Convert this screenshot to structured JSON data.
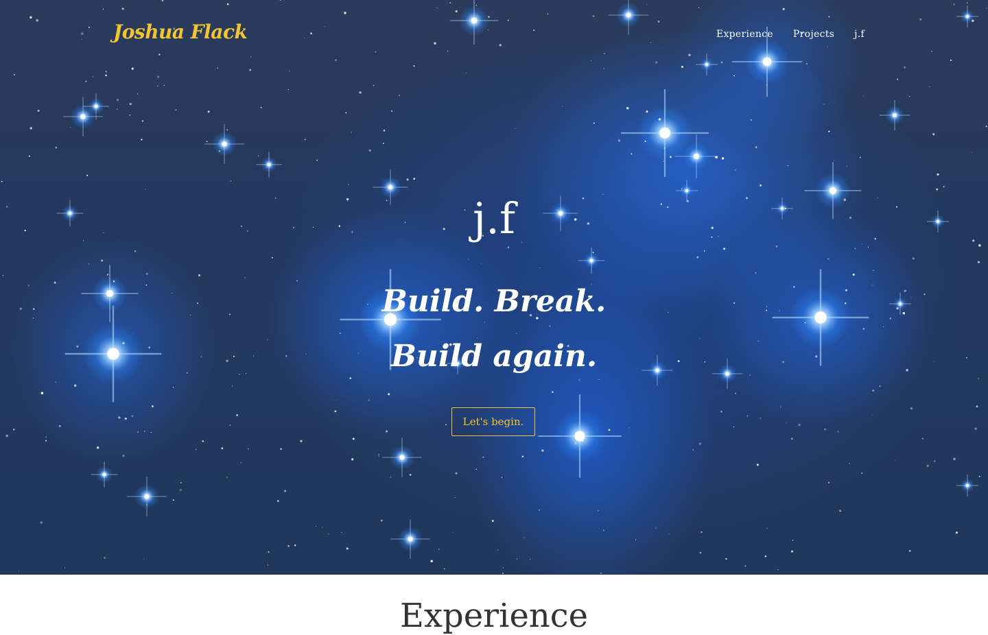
{
  "nav": {
    "logo": "Joshua Flack",
    "links": [
      {
        "label": "Experience"
      },
      {
        "label": "Projects"
      },
      {
        "label": "j.f"
      }
    ]
  },
  "hero": {
    "mark": "j.f",
    "line1": "Build. Break.",
    "line2": "Build again.",
    "cta": "Let's begin."
  },
  "next_section": {
    "title": "Experience"
  },
  "colors": {
    "accent": "#f5c531",
    "hero_bg": "#24385e",
    "text_light": "#ffffff"
  }
}
